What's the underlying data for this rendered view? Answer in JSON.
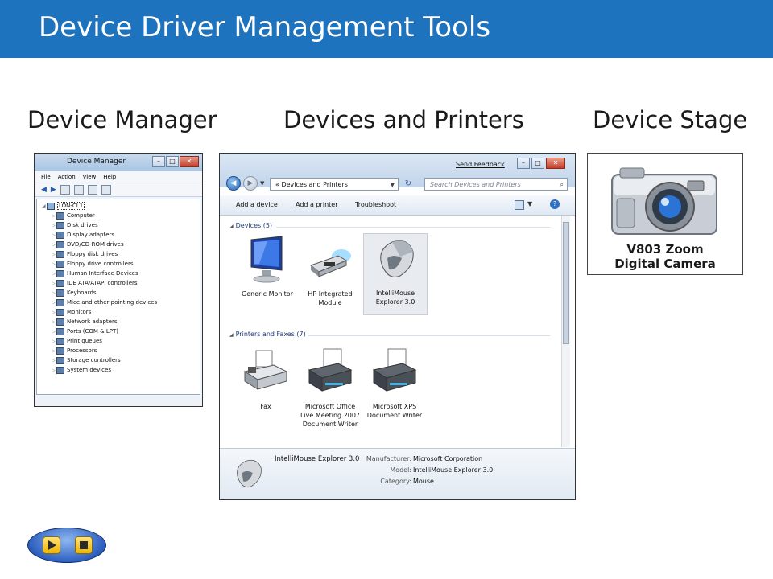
{
  "slide": {
    "title": "Device Driver Management Tools",
    "labels": {
      "device_manager": "Device Manager",
      "devices_printers": "Devices and Printers",
      "device_stage": "Device Stage"
    }
  },
  "device_manager": {
    "window_title": "Device Manager",
    "menu": [
      "File",
      "Action",
      "View",
      "Help"
    ],
    "root": "LON-CL1",
    "items": [
      "Computer",
      "Disk drives",
      "Display adapters",
      "DVD/CD-ROM drives",
      "Floppy disk drives",
      "Floppy drive controllers",
      "Human Interface Devices",
      "IDE ATA/ATAPI controllers",
      "Keyboards",
      "Mice and other pointing devices",
      "Monitors",
      "Network adapters",
      "Ports (COM & LPT)",
      "Print queues",
      "Processors",
      "Storage controllers",
      "System devices"
    ]
  },
  "devices_printers": {
    "send_feedback": "Send Feedback",
    "address_prefix": "«",
    "address": "Devices and Printers",
    "search_placeholder": "Search Devices and Printers",
    "commands": [
      "Add a device",
      "Add a printer",
      "Troubleshoot"
    ],
    "group_devices": "Devices (5)",
    "group_printers": "Printers and Faxes (7)",
    "devices": [
      {
        "label": "Generic Monitor",
        "icon": "monitor-icon"
      },
      {
        "label": "HP Integrated Module",
        "icon": "usb-module-icon"
      },
      {
        "label": "IntelliMouse Explorer 3.0",
        "icon": "mouse-icon",
        "selected": true
      }
    ],
    "printers": [
      {
        "label": "Fax",
        "icon": "fax-icon"
      },
      {
        "label": "Microsoft Office Live Meeting 2007 Document Writer",
        "icon": "printer-icon"
      },
      {
        "label": "Microsoft XPS Document Writer",
        "icon": "printer-icon"
      }
    ],
    "details": {
      "name": "IntelliMouse Explorer 3.0",
      "manufacturer_label": "Manufacturer:",
      "manufacturer": "Microsoft Corporation",
      "model_label": "Model:",
      "model": "IntelliMouse Explorer 3.0",
      "category_label": "Category:",
      "category": "Mouse"
    }
  },
  "device_stage": {
    "line1": "V803 Zoom",
    "line2": "Digital Camera",
    "icon": "camera-icon"
  },
  "player": {
    "play_icon": "play-icon",
    "stop_icon": "stop-icon"
  },
  "colors": {
    "banner": "#1e73be",
    "player": "#2d5fbf",
    "player_buttons": "#f0b400"
  }
}
